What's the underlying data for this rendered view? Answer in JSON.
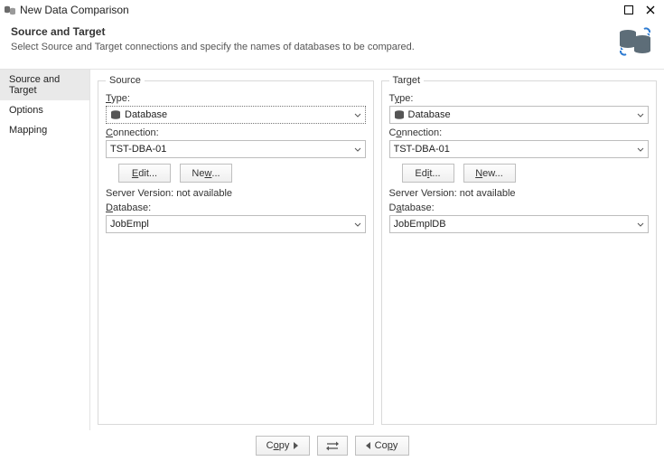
{
  "window": {
    "title": "New Data Comparison"
  },
  "header": {
    "title": "Source and Target",
    "subtitle": "Select Source and Target connections and specify the names of databases to be compared."
  },
  "nav": {
    "items": [
      {
        "label": "Source and Target",
        "active": true
      },
      {
        "label": "Options",
        "active": false
      },
      {
        "label": "Mapping",
        "active": false
      }
    ]
  },
  "source": {
    "legend": "Source",
    "type_label": "Type:",
    "type_value": "Database",
    "connection_label": "Connection:",
    "connection_value": "TST-DBA-01",
    "edit_btn": "Edit...",
    "new_btn": "New...",
    "server_version": "Server Version: not available",
    "database_label": "Database:",
    "database_value": "JobEmpl"
  },
  "target": {
    "legend": "Target",
    "type_label": "Type:",
    "type_value": "Database",
    "connection_label": "Connection:",
    "connection_value": "TST-DBA-01",
    "edit_btn": "Edit...",
    "new_btn": "New...",
    "server_version": "Server Version: not available",
    "database_label": "Database:",
    "database_value": "JobEmplDB"
  },
  "footer": {
    "copy_right": "Copy",
    "copy_left": "Copy"
  }
}
